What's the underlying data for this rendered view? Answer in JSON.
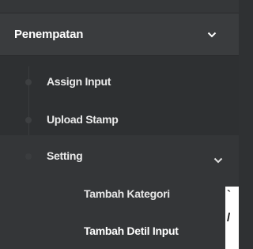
{
  "menu": {
    "section": {
      "label": "Penempatan"
    },
    "items": [
      {
        "label": "Assign Input"
      },
      {
        "label": "Upload Stamp"
      },
      {
        "label": "Setting",
        "children": [
          {
            "label": "Tambah Kategori"
          },
          {
            "label": "Tambah Detil Input"
          }
        ]
      }
    ]
  },
  "colors": {
    "sidebar_bg": "#2f3133",
    "section_bg": "#3a3c3e",
    "submenu_bg": "#343638",
    "text": "#ffffff"
  },
  "icons": {
    "expand": "chevron-down-icon"
  }
}
